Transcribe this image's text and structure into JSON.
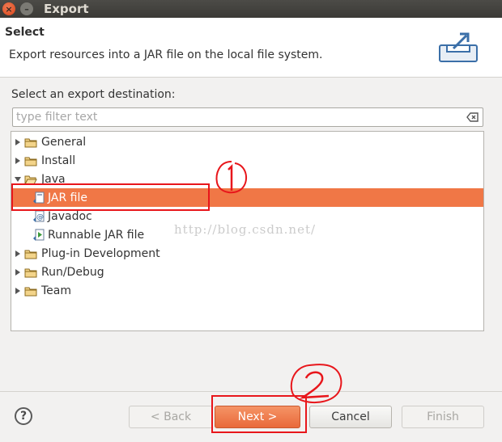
{
  "window": {
    "title": "Export",
    "close_glyph": "×",
    "min_glyph": "–"
  },
  "banner": {
    "title": "Select",
    "description": "Export resources into a JAR file on the local file system."
  },
  "destination": {
    "label": "Select an export destination:",
    "filter_placeholder": "type filter text",
    "filter_value": ""
  },
  "tree": {
    "items": [
      {
        "label": "General",
        "expanded": false,
        "level": 0
      },
      {
        "label": "Install",
        "expanded": false,
        "level": 0
      },
      {
        "label": "Java",
        "expanded": true,
        "level": 0
      },
      {
        "label": "JAR file",
        "level": 1,
        "selected": true
      },
      {
        "label": "Javadoc",
        "level": 1
      },
      {
        "label": "Runnable JAR file",
        "level": 1
      },
      {
        "label": "Plug-in Development",
        "expanded": false,
        "level": 0
      },
      {
        "label": "Run/Debug",
        "expanded": false,
        "level": 0
      },
      {
        "label": "Team",
        "expanded": false,
        "level": 0
      }
    ]
  },
  "watermark": "http://blog.csdn.net/",
  "buttons": {
    "help": "?",
    "back": "< Back",
    "next": "Next >",
    "cancel": "Cancel",
    "finish": "Finish"
  },
  "colors": {
    "selection": "#f07746",
    "annotation": "#e8161b"
  }
}
